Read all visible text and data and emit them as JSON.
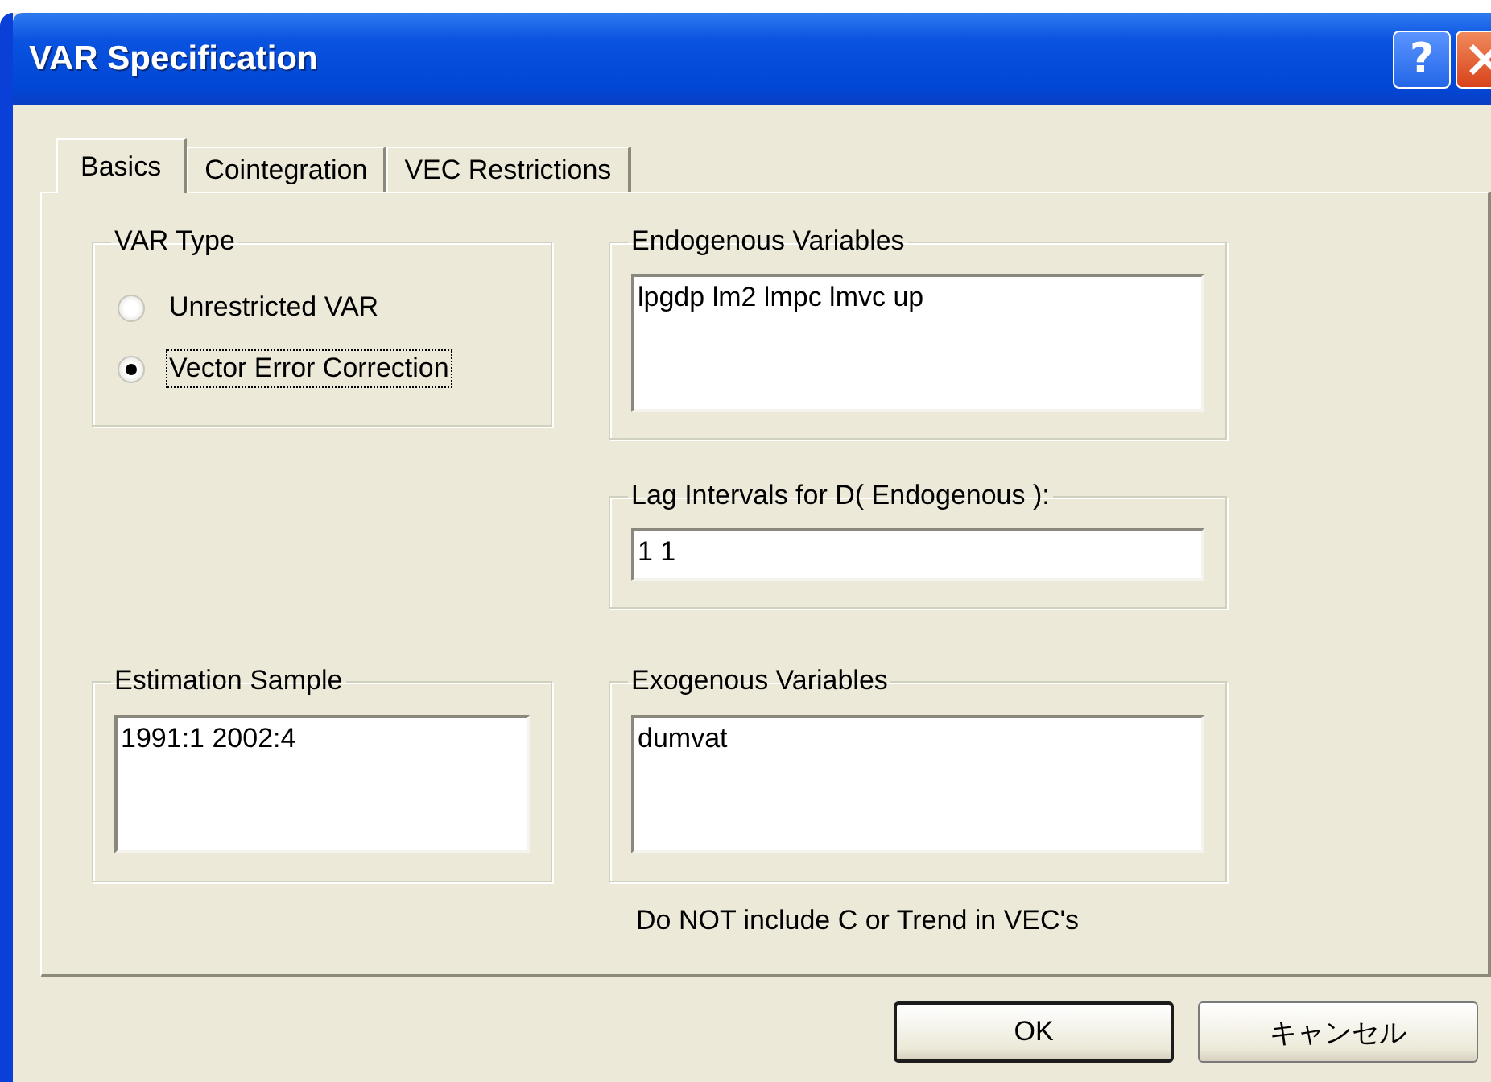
{
  "window": {
    "title": "VAR Specification"
  },
  "title_buttons": [
    {
      "kind": "help",
      "label": "?"
    },
    {
      "kind": "close"
    }
  ],
  "tabs": [
    {
      "label": "Basics",
      "selected": true
    },
    {
      "label": "Cointegration",
      "selected": false
    },
    {
      "label": "VEC Restrictions",
      "selected": false
    }
  ],
  "var_type": {
    "title": "VAR Type",
    "options": [
      {
        "label": "Unrestricted VAR",
        "selected": false,
        "focused": false
      },
      {
        "label": "Vector Error Correction",
        "selected": true,
        "focused": true
      }
    ]
  },
  "endogenous": {
    "label": "Endogenous Variables",
    "value": "lpgdp lm2 lmpc lmvc up"
  },
  "lag_intervals": {
    "label": "Lag Intervals for D( Endogenous ):",
    "value": "1 1"
  },
  "sample": {
    "label": "Estimation Sample",
    "value": "1991:1  2002:4"
  },
  "exogenous": {
    "label": "Exogenous Variables",
    "value": "dumvat",
    "note": "Do NOT include C or Trend in VEC's"
  },
  "buttons": [
    {
      "label": "OK",
      "default": true
    },
    {
      "label": "キャンセル",
      "default": false
    }
  ]
}
